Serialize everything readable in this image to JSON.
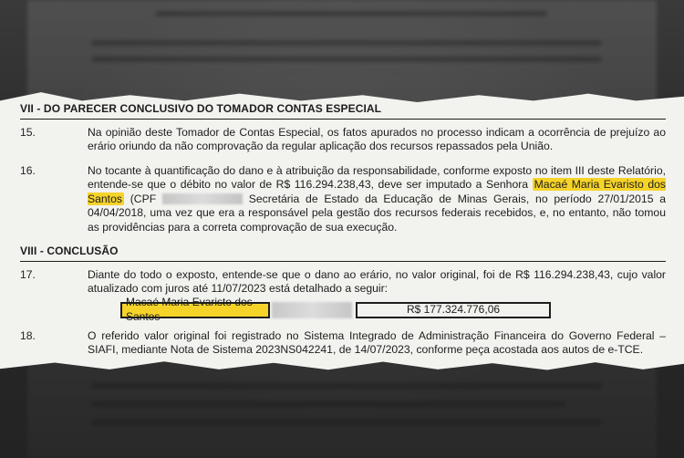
{
  "section7": {
    "title": "VII - DO PARECER CONCLUSIVO DO TOMADOR CONTAS ESPECIAL",
    "p15": {
      "num": "15.",
      "text": "Na opinião deste Tomador de Contas Especial, os fatos apurados no processo indicam a ocorrência de prejuízo ao erário oriundo da não comprovação da regular aplicação dos recursos repassados pela União."
    },
    "p16": {
      "num": "16.",
      "text_a": "No tocante à quantificação do dano e à atribuição da responsabilidade, conforme exposto no item III deste Relatório, entende-se que o débito no valor de R$ 116.294.238,43, deve ser imputado a Senhora",
      "name": "Macaé Maria Evaristo dos Santos",
      "text_b": "(CPF",
      "text_c": "Secretária de Estado da Educação de Minas Gerais, no período 27/01/2015 a 04/04/2018, uma vez que era a responsável pela gestão dos recursos federais recebidos, e, no entanto, não tomou as providências para a correta comprovação de sua execução."
    }
  },
  "section8": {
    "title": "VIII - CONCLUSÃO",
    "p17": {
      "num": "17.",
      "text": "Diante do todo o exposto, entende-se que o dano ao erário, no valor original, foi de R$ 116.294.238,43, cujo valor atualizado com juros até 11/07/2023 está detalhado a seguir:"
    },
    "table": {
      "name": "Macaé Maria Evaristo dos Santos",
      "amount": "R$ 177.324.776,06"
    },
    "p18": {
      "num": "18.",
      "text": "O referido valor original foi registrado no Sistema Integrado de Administração Financeira do Governo Federal – SIAFI, mediante Nota de Sistema 2023NS042241, de 14/07/2023, conforme peça acostada aos autos de e-TCE."
    }
  },
  "colors": {
    "highlight": "#f6d329",
    "paper": "#f2f2ef",
    "background": "#2b2b2b"
  }
}
